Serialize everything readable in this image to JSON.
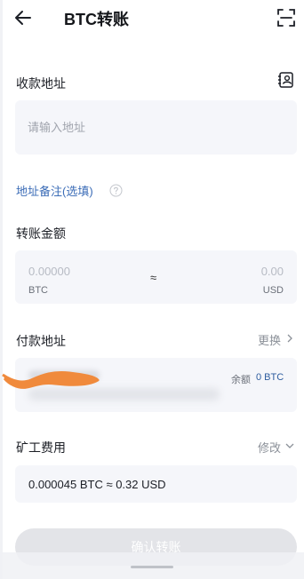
{
  "header": {
    "title": "BTC转账",
    "back_icon": "arrow-left-icon",
    "scan_icon": "scan-icon"
  },
  "receive": {
    "label": "收款地址",
    "placeholder": "请输入地址",
    "contact_icon": "address-book-icon"
  },
  "memo": {
    "label": "地址备注(选填)",
    "help_icon": "question-circle-icon"
  },
  "amount": {
    "label": "转账金额",
    "value": "0.00000",
    "unit": "BTC",
    "approx": "≈",
    "fiat_value": "0.00",
    "fiat_unit": "USD"
  },
  "payer": {
    "label": "付款地址",
    "change_label": "更换",
    "balance_label": "余额",
    "balance_value": "0 BTC"
  },
  "fee": {
    "label": "矿工费用",
    "edit_label": "修改",
    "value_text": "0.000045 BTC ≈ 0.32 USD"
  },
  "confirm": {
    "label": "确认转账"
  },
  "colors": {
    "accent": "#3b6cb7",
    "box_bg": "#f5f6fa",
    "button_disabled": "#e3e4e8",
    "scribble": "#f08a3c"
  }
}
